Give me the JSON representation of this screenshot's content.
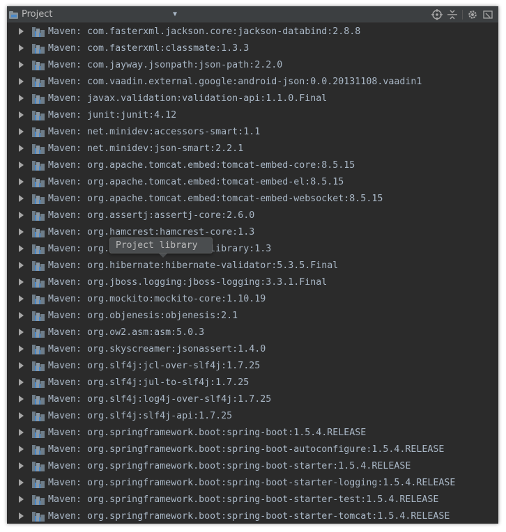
{
  "header": {
    "title": "Project",
    "icons": [
      "locate-icon",
      "collapse-all-icon",
      "settings-gear-icon",
      "hide-icon"
    ]
  },
  "tree": {
    "prefix": "Maven: ",
    "items": [
      "com.fasterxml.jackson.core:jackson-databind:2.8.8",
      "com.fasterxml:classmate:1.3.3",
      "com.jayway.jsonpath:json-path:2.2.0",
      "com.vaadin.external.google:android-json:0.0.20131108.vaadin1",
      "javax.validation:validation-api:1.1.0.Final",
      "junit:junit:4.12",
      "net.minidev:accessors-smart:1.1",
      "net.minidev:json-smart:2.2.1",
      "org.apache.tomcat.embed:tomcat-embed-core:8.5.15",
      "org.apache.tomcat.embed:tomcat-embed-el:8.5.15",
      "org.apache.tomcat.embed:tomcat-embed-websocket:8.5.15",
      "org.assertj:assertj-core:2.6.0",
      "org.hamcrest:hamcrest-core:1.3",
      "org.hamcrest:hamcrest-library:1.3",
      "org.hibernate:hibernate-validator:5.3.5.Final",
      "org.jboss.logging:jboss-logging:3.3.1.Final",
      "org.mockito:mockito-core:1.10.19",
      "org.objenesis:objenesis:2.1",
      "org.ow2.asm:asm:5.0.3",
      "org.skyscreamer:jsonassert:1.4.0",
      "org.slf4j:jcl-over-slf4j:1.7.25",
      "org.slf4j:jul-to-slf4j:1.7.25",
      "org.slf4j:log4j-over-slf4j:1.7.25",
      "org.slf4j:slf4j-api:1.7.25",
      "org.springframework.boot:spring-boot:1.5.4.RELEASE",
      "org.springframework.boot:spring-boot-autoconfigure:1.5.4.RELEASE",
      "org.springframework.boot:spring-boot-starter:1.5.4.RELEASE",
      "org.springframework.boot:spring-boot-starter-logging:1.5.4.RELEASE",
      "org.springframework.boot:spring-boot-starter-test:1.5.4.RELEASE",
      "org.springframework.boot:spring-boot-starter-tomcat:1.5.4.RELEASE"
    ]
  },
  "tooltip": {
    "text": "Project library"
  },
  "colors": {
    "panel_bg": "#2b2b2b",
    "header_bg": "#3c3f41",
    "text": "#a9b7c6",
    "accent": "#4a88c7"
  }
}
